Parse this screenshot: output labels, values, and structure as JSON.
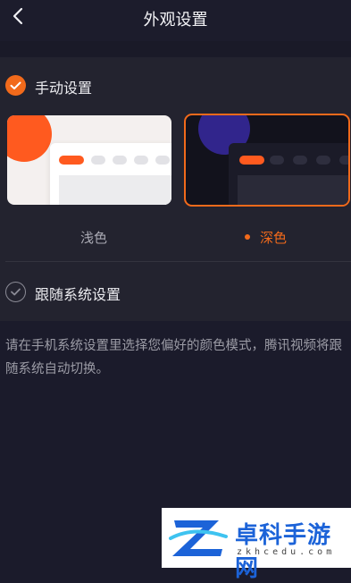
{
  "header": {
    "title": "外观设置"
  },
  "options": {
    "manual": {
      "label": "手动设置",
      "checked": true
    },
    "follow_system": {
      "label": "跟随系统设置",
      "checked": false
    }
  },
  "themes": {
    "light": {
      "label": "浅色",
      "selected": false
    },
    "dark": {
      "label": "深色",
      "selected": true
    }
  },
  "description": "请在手机系统设置里选择您偏好的颜色模式，腾讯视频将跟随系统自动切换。",
  "watermark": {
    "title": "卓科手游网",
    "subtitle": "zkhcedu.com"
  },
  "colors": {
    "accent": "#f26a1b",
    "background": "#1b1b2b",
    "panel": "#23232f"
  }
}
